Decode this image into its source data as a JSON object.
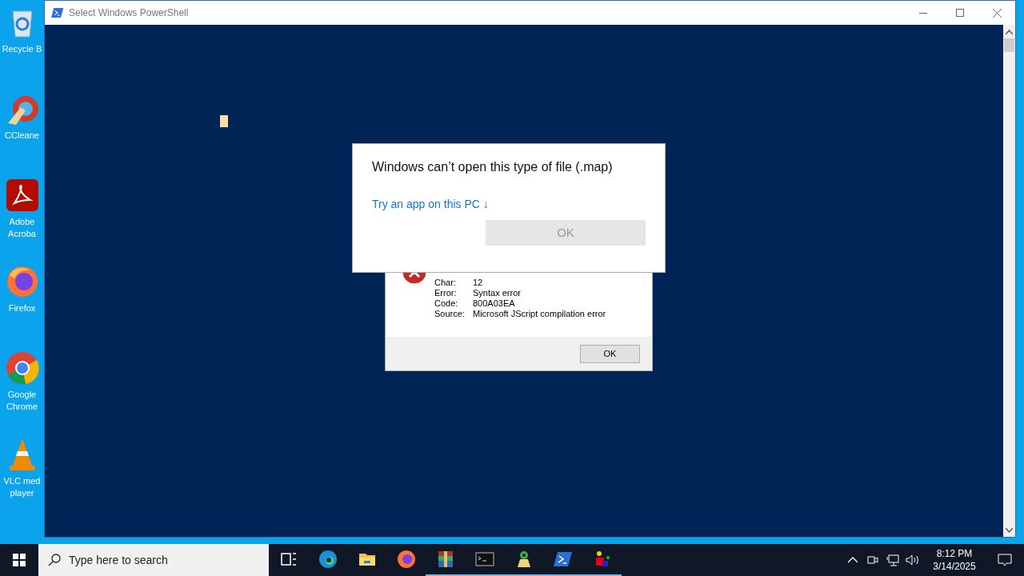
{
  "desktop_icons": [
    {
      "label": "Recycle B",
      "kind": "recycle"
    },
    {
      "label": "CCleane",
      "kind": "ccleaner"
    },
    {
      "label": "Adobe Acroba",
      "kind": "acrobat"
    },
    {
      "label": "Firefox",
      "kind": "firefox"
    },
    {
      "label": "Google Chrome",
      "kind": "chrome"
    },
    {
      "label": "VLC med player",
      "kind": "vlc"
    }
  ],
  "window": {
    "title": "Select Windows PowerShell"
  },
  "open_with_dialog": {
    "message": "Windows can’t open this type of file (.map)",
    "link": "Try an app on this PC",
    "link_arrow": "↓",
    "button": {
      "label": "OK",
      "disabled": true
    }
  },
  "script_error_dialog": {
    "rows": [
      {
        "label": "Char:",
        "value": "12"
      },
      {
        "label": "Error:",
        "value": "Syntax error"
      },
      {
        "label": "Code:",
        "value": "800A03EA"
      },
      {
        "label": "Source:",
        "value": "Microsoft JScript compilation error"
      }
    ],
    "button": "OK"
  },
  "taskbar": {
    "search_placeholder": "Type here to search",
    "apps": [
      {
        "kind": "taskview",
        "running": false
      },
      {
        "kind": "edge",
        "running": false
      },
      {
        "kind": "folder",
        "running": false
      },
      {
        "kind": "firefox",
        "running": false
      },
      {
        "kind": "archive",
        "running": true
      },
      {
        "kind": "terminal",
        "running": true
      },
      {
        "kind": "green",
        "running": true
      },
      {
        "kind": "powershell",
        "running": true
      },
      {
        "kind": "blocks",
        "running": true
      }
    ],
    "time": "8:12 PM",
    "date": "3/14/2025"
  }
}
